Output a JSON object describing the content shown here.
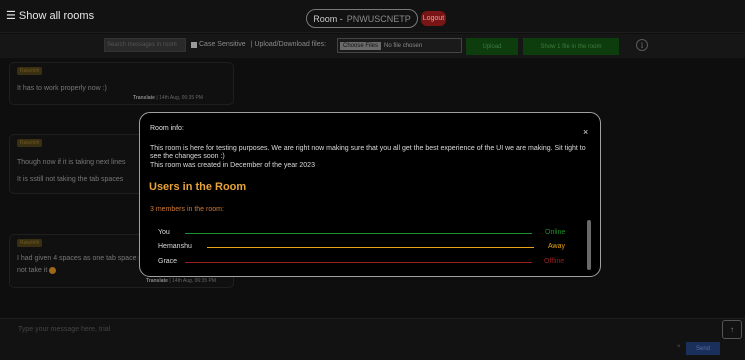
{
  "header": {
    "show_all_rooms": "Show all rooms",
    "room_label": "Room -",
    "room_id": "PNWUSCNETP",
    "logout": "Logout"
  },
  "toolbar": {
    "search_placeholder": "Search messages in room",
    "case_sensitive": "Case Sensitive",
    "upload_label": "| Upload/Download files:",
    "choose_files": "Choose Files",
    "no_file": "No file chosen",
    "upload": "Upload",
    "show_files": "Show 1 file in the room"
  },
  "messages": [
    {
      "sender": "Rakshith",
      "lines": [
        "It has to work properly now :)"
      ],
      "action": "Translate",
      "time": "14th Aug, 06:35 PM"
    },
    {
      "sender": "Rakshith",
      "lines": [
        "Though now if it is taking next lines",
        "It is sstill not taking the tab spaces"
      ],
      "action": "",
      "time": ""
    },
    {
      "sender": "Rakshith",
      "lines": [
        "I had given 4 spaces as one tab space in the above msg. It did",
        "not take it"
      ],
      "action": "Translate",
      "time": "14th Aug, 06:35 PM"
    }
  ],
  "composer": {
    "placeholder": "Type your message here, trial",
    "send": "Send",
    "send_x": "×"
  },
  "modal": {
    "title": "Room info:",
    "close": "×",
    "description": "This room is here for testing purposes. We are right now making sure that you all get the best experience of the UI we are making. Sit tight to see the changes soon :)",
    "created": "This room was created in December of the year 2023",
    "users_heading": "Users in the Room",
    "member_count": "3 members in the room:",
    "users": [
      {
        "name": "You",
        "status": "Online",
        "color": "#1e8f2a"
      },
      {
        "name": "Hemanshu",
        "status": "Away",
        "color": "#e8a317"
      },
      {
        "name": "Grace",
        "status": "Offline",
        "color": "#9a1e1e"
      }
    ]
  },
  "colors": {
    "accent_orange": "#e8a33a",
    "logout_red": "#7a1515",
    "online": "#1e8f2a",
    "away": "#e8a317",
    "offline": "#9a1e1e"
  }
}
